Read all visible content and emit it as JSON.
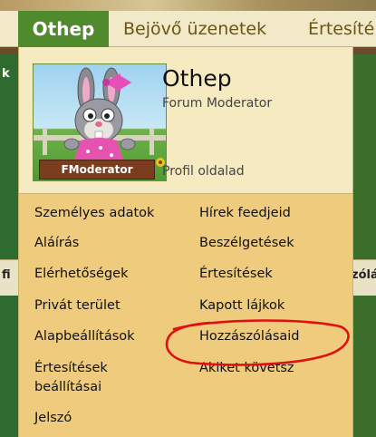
{
  "nav": {
    "tabs": [
      {
        "label": "Othep"
      },
      {
        "label": "Bejövő üzenetek"
      },
      {
        "label": "Értesíté"
      }
    ]
  },
  "profile": {
    "name": "Othep",
    "role": "Forum Moderator",
    "link_label": "Profil oldalad",
    "avatar_plate": "FModerator"
  },
  "menu": {
    "left": [
      {
        "label": "Személyes adatok"
      },
      {
        "label": "Aláírás"
      },
      {
        "label": "Elérhetőségek"
      },
      {
        "label": "Privát terület"
      },
      {
        "label": "Alapbeállítások"
      },
      {
        "label": "Értesítések beállításai"
      },
      {
        "label": "Jelszó"
      }
    ],
    "right": [
      {
        "label": "Hírek feedjeid"
      },
      {
        "label": "Beszélgetések"
      },
      {
        "label": "Értesítések"
      },
      {
        "label": "Kapott lájkok"
      },
      {
        "label": "Hozzászólásaid"
      },
      {
        "label": "Akiket követsz"
      }
    ]
  },
  "background": {
    "left_fragment_1": "k",
    "left_fragment_2": "fi",
    "right_fragment": "zólá"
  },
  "colors": {
    "active_tab": "#4f8a2d",
    "panel": "#f3e4b0",
    "menu": "#eecb7d",
    "annotation": "#e01010"
  }
}
